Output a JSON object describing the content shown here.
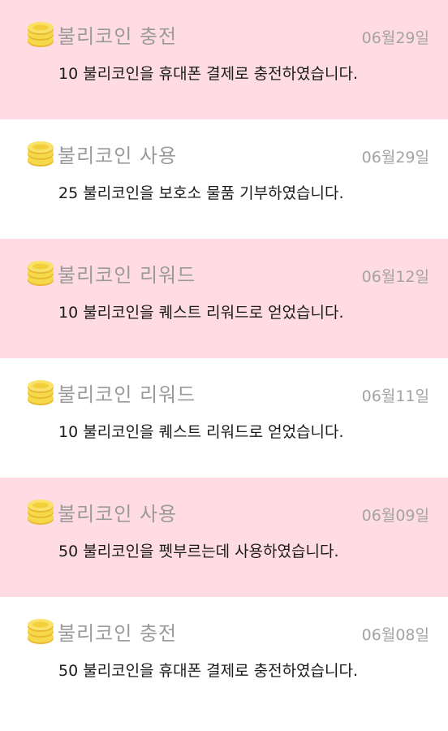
{
  "colors": {
    "pink_row": "#ffdce3",
    "white_row": "#ffffff",
    "title_gray": "#9a9a9a",
    "date_gray": "#a3a3a3",
    "desc_text": "#1a1a1a",
    "coin_gold": "#f6d94a"
  },
  "items": [
    {
      "icon": "coin-stack-icon",
      "title": "불리코인 충전",
      "date": "06월29일",
      "desc": "10 불리코인을 휴대폰 결제로 충전하였습니다."
    },
    {
      "icon": "coin-stack-icon",
      "title": "불리코인 사용",
      "date": "06월29일",
      "desc": "25 불리코인을 보호소 물품 기부하였습니다."
    },
    {
      "icon": "coin-stack-icon",
      "title": "불리코인 리워드",
      "date": "06월12일",
      "desc": "10 불리코인을 퀘스트 리워드로 얻었습니다."
    },
    {
      "icon": "coin-stack-icon",
      "title": "불리코인 리워드",
      "date": "06월11일",
      "desc": "10 불리코인을 퀘스트 리워드로 얻었습니다."
    },
    {
      "icon": "coin-stack-icon",
      "title": "불리코인 사용",
      "date": "06월09일",
      "desc": "50 불리코인을 펫부르는데 사용하였습니다."
    },
    {
      "icon": "coin-stack-icon",
      "title": "불리코인 충전",
      "date": "06월08일",
      "desc": "50 불리코인을 휴대폰 결제로 충전하였습니다."
    }
  ]
}
